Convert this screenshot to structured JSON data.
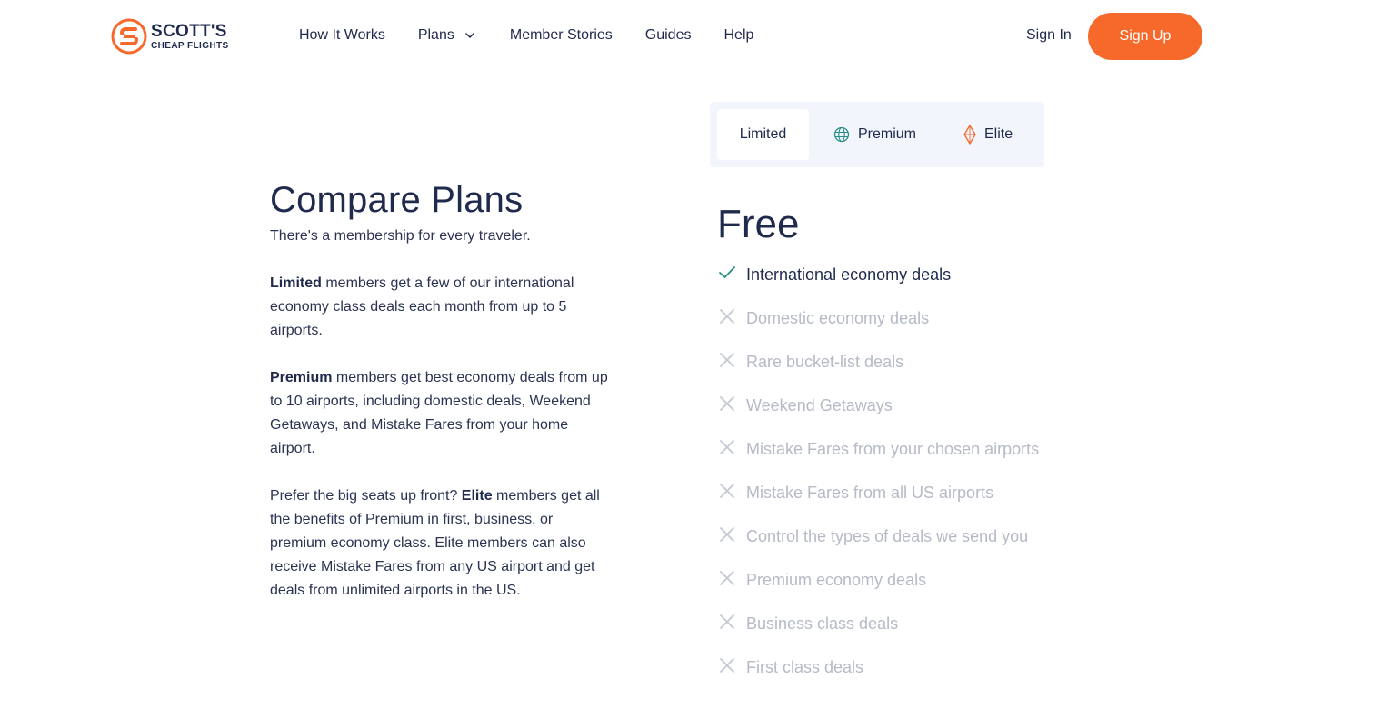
{
  "brand": {
    "line1": "SCOTT'S",
    "line2": "CHEAP FLIGHTS",
    "accent": "#f7692a",
    "navy": "#1f2a4d"
  },
  "nav": {
    "how_it_works": "How It Works",
    "plans": "Plans",
    "member_stories": "Member Stories",
    "guides": "Guides",
    "help": "Help"
  },
  "auth": {
    "sign_in": "Sign In",
    "sign_up": "Sign Up"
  },
  "intro": {
    "title": "Compare Plans",
    "subtitle": "There's a membership for every traveler.",
    "limited": {
      "bold": "Limited",
      "text": " members get a few of our international economy class deals each month from up to 5 airports."
    },
    "premium": {
      "bold": "Premium",
      "text": " members get best economy deals from up to 10 airports, including domestic deals, Weekend Getaways, and Mistake Fares from your home airport."
    },
    "elite": {
      "before": "Prefer the big seats up front? ",
      "bold": "Elite",
      "text": " members get all the benefits of Premium in first, business, or premium economy class. Elite members can also receive Mistake Fares from any US airport and get deals from unlimited airports in the US."
    }
  },
  "tabs": {
    "limited": "Limited",
    "premium": "Premium",
    "elite": "Elite",
    "selected": "Limited"
  },
  "plan": {
    "price": "Free",
    "features": [
      {
        "label": "International economy deals",
        "included": true,
        "icon": "check-icon"
      },
      {
        "label": "Domestic economy deals",
        "included": false,
        "icon": "x-icon"
      },
      {
        "label": "Rare bucket-list deals",
        "included": false,
        "icon": "x-icon"
      },
      {
        "label": "Weekend Getaways",
        "included": false,
        "icon": "x-icon"
      },
      {
        "label": "Mistake Fares from your chosen airports",
        "included": false,
        "icon": "x-icon"
      },
      {
        "label": "Mistake Fares from all US airports",
        "included": false,
        "icon": "x-icon"
      },
      {
        "label": "Control the types of deals we send you",
        "included": false,
        "icon": "x-icon"
      },
      {
        "label": "Premium economy deals",
        "included": false,
        "icon": "x-icon"
      },
      {
        "label": "Business class deals",
        "included": false,
        "icon": "x-icon"
      },
      {
        "label": "First class deals",
        "included": false,
        "icon": "x-icon"
      }
    ]
  }
}
